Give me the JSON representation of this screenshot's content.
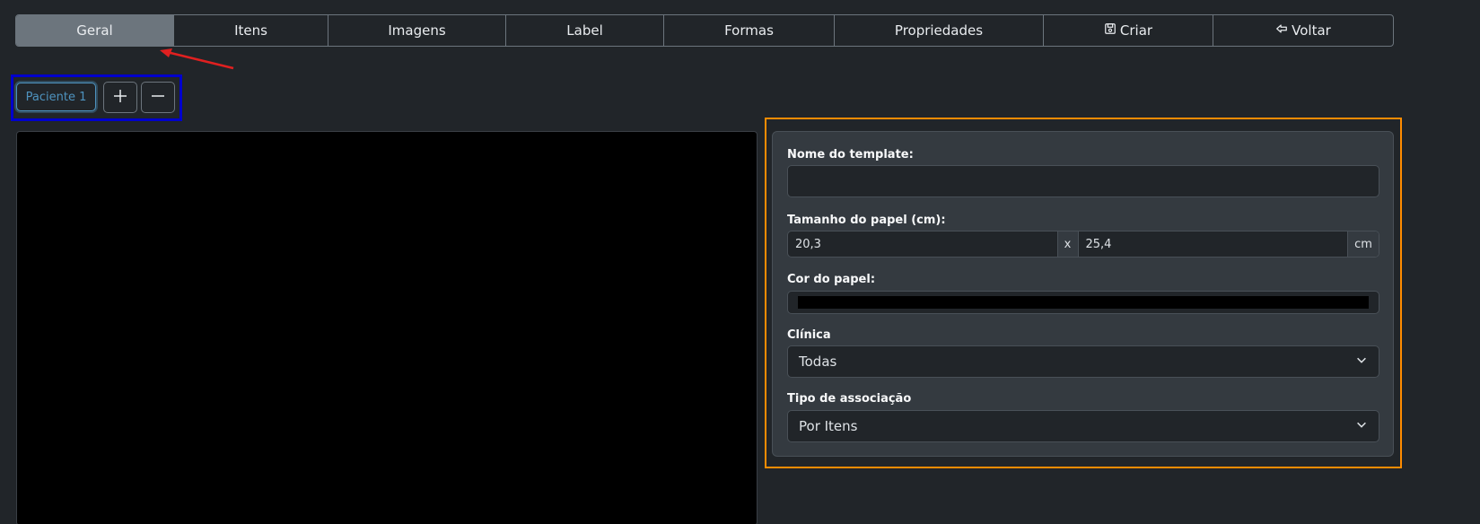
{
  "nav": {
    "tabs": [
      {
        "label": "Geral",
        "icon": null,
        "active": true
      },
      {
        "label": "Itens",
        "icon": null,
        "active": false
      },
      {
        "label": "Imagens",
        "icon": null,
        "active": false
      },
      {
        "label": "Label",
        "icon": null,
        "active": false
      },
      {
        "label": "Formas",
        "icon": null,
        "active": false
      },
      {
        "label": "Propriedades",
        "icon": null,
        "active": false
      },
      {
        "label": "Criar",
        "icon": "save-icon",
        "active": false
      },
      {
        "label": "Voltar",
        "icon": "arrow-left-icon",
        "active": false
      }
    ]
  },
  "patients": {
    "tab_label": "Paciente 1",
    "add_icon": "plus-icon",
    "remove_icon": "minus-icon"
  },
  "form": {
    "template_name": {
      "label": "Nome do template:",
      "value": ""
    },
    "paper_size": {
      "label": "Tamanho do papel (cm):",
      "width": "20,3",
      "separator": "x",
      "height": "25,4",
      "unit": "cm"
    },
    "paper_color": {
      "label": "Cor do papel:",
      "value": "#000000"
    },
    "clinic": {
      "label": "Clínica",
      "selected": "Todas"
    },
    "association": {
      "label": "Tipo de associação",
      "selected": "Por Itens"
    }
  },
  "colors": {
    "background": "#212529",
    "card": "#343a40",
    "active_tab": "#6c757d",
    "canvas": "#000000",
    "annotation_arrow": "#e02020",
    "annotation_blue": "#0000cc",
    "annotation_orange": "#ff8c00"
  }
}
